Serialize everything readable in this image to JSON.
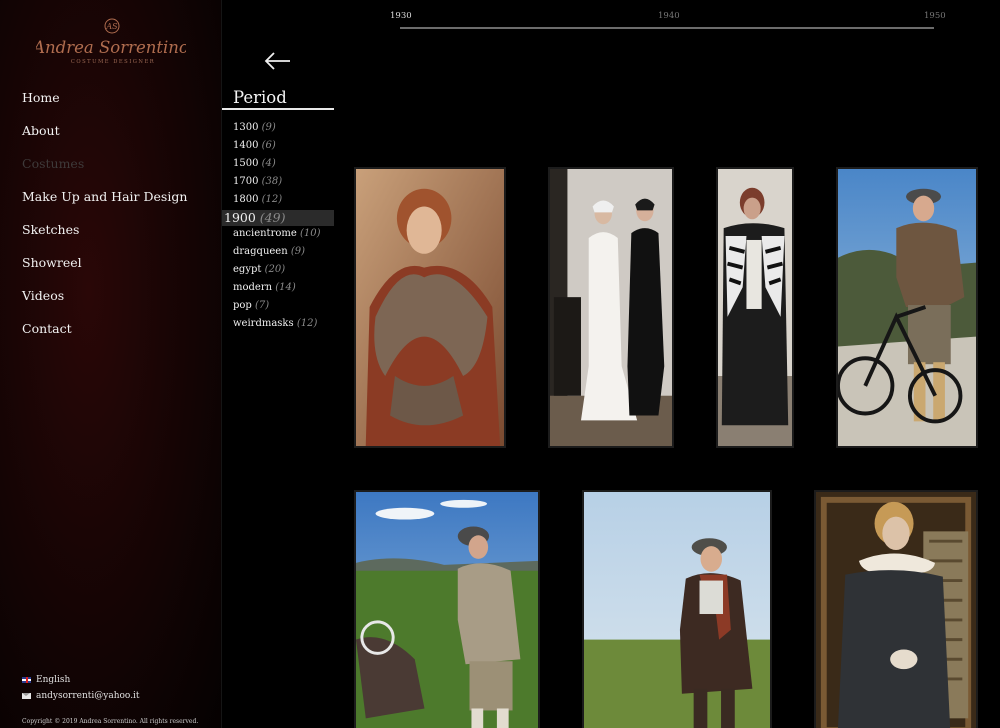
{
  "sidebar": {
    "logo_text": "Andrea Sorrentino",
    "logo_subtitle": "COSTUME DESIGNER",
    "logo_monogram": "AS",
    "nav": [
      {
        "label": "Home",
        "active": false
      },
      {
        "label": "About",
        "active": false
      },
      {
        "label": "Costumes",
        "active": true
      },
      {
        "label": "Make Up and Hair Design",
        "active": false
      },
      {
        "label": "Sketches",
        "active": false
      },
      {
        "label": "Showreel",
        "active": false
      },
      {
        "label": "Videos",
        "active": false
      },
      {
        "label": "Contact",
        "active": false
      }
    ],
    "language": "English",
    "email": "andysorrenti@yahoo.it",
    "copyright": "Copyright © 2019 Andrea Sorrentino. All rights reserved."
  },
  "period": {
    "title": "Period",
    "items": [
      {
        "label": "1300",
        "count": "(9)"
      },
      {
        "label": "1400",
        "count": "(6)"
      },
      {
        "label": "1500",
        "count": "(4)"
      },
      {
        "label": "1700",
        "count": "(38)"
      },
      {
        "label": "1800",
        "count": "(12)"
      },
      {
        "label": "1900",
        "count": "(49)",
        "active": true
      },
      {
        "label": "ancientrome",
        "count": "(10)"
      },
      {
        "label": "dragqueen",
        "count": "(9)"
      },
      {
        "label": "egypt",
        "count": "(20)"
      },
      {
        "label": "modern",
        "count": "(14)"
      },
      {
        "label": "pop",
        "count": "(7)"
      },
      {
        "label": "weirdmasks",
        "count": "(12)"
      }
    ]
  },
  "timeline": {
    "labels": [
      "1930",
      "1940",
      "1950"
    ],
    "selected": "1930"
  },
  "gallery": {
    "photo_icons": [
      "woman-in-fur-coat-photo",
      "two-women-in-evening-gowns-photo",
      "man-in-zebra-coat-photo",
      "man-with-bicycle-photo",
      "boy-on-hillside-photo",
      "boy-with-scarf-photo",
      "woman-in-fur-collar-photo"
    ]
  },
  "colors": {
    "background": "#000000",
    "sidebar_red": "#2a0707",
    "logo_copper": "#b06d4f",
    "active_period_bg": "#2b2b2b",
    "muted_nav": "#3e3a3a"
  }
}
